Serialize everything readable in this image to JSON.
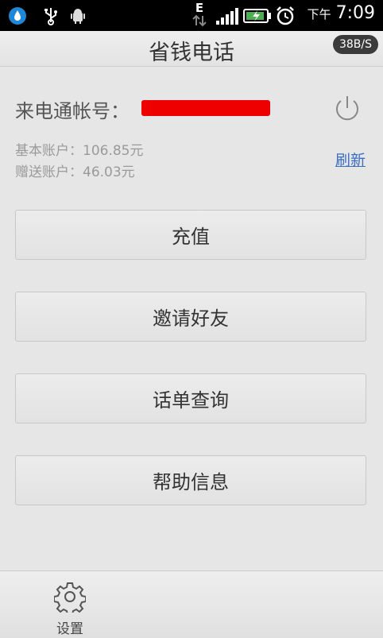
{
  "statusbar": {
    "network_type": "E",
    "time_ampm": "下午",
    "time": "7:09"
  },
  "titlebar": {
    "title": "省钱电话",
    "speed": "38B/S"
  },
  "account": {
    "label": "来电通帐号：",
    "basic_balance": "基本账户：106.85元",
    "gift_balance": "赠送账户：46.03元",
    "refresh_label": "刷新"
  },
  "menu": {
    "items": [
      {
        "label": "充值"
      },
      {
        "label": "邀请好友"
      },
      {
        "label": "话单查询"
      },
      {
        "label": "帮助信息"
      }
    ]
  },
  "bottombar": {
    "settings_label": "设置"
  },
  "colors": {
    "accent_link": "#3a6fc4",
    "redaction": "#e00000",
    "status_bg": "#000000"
  }
}
